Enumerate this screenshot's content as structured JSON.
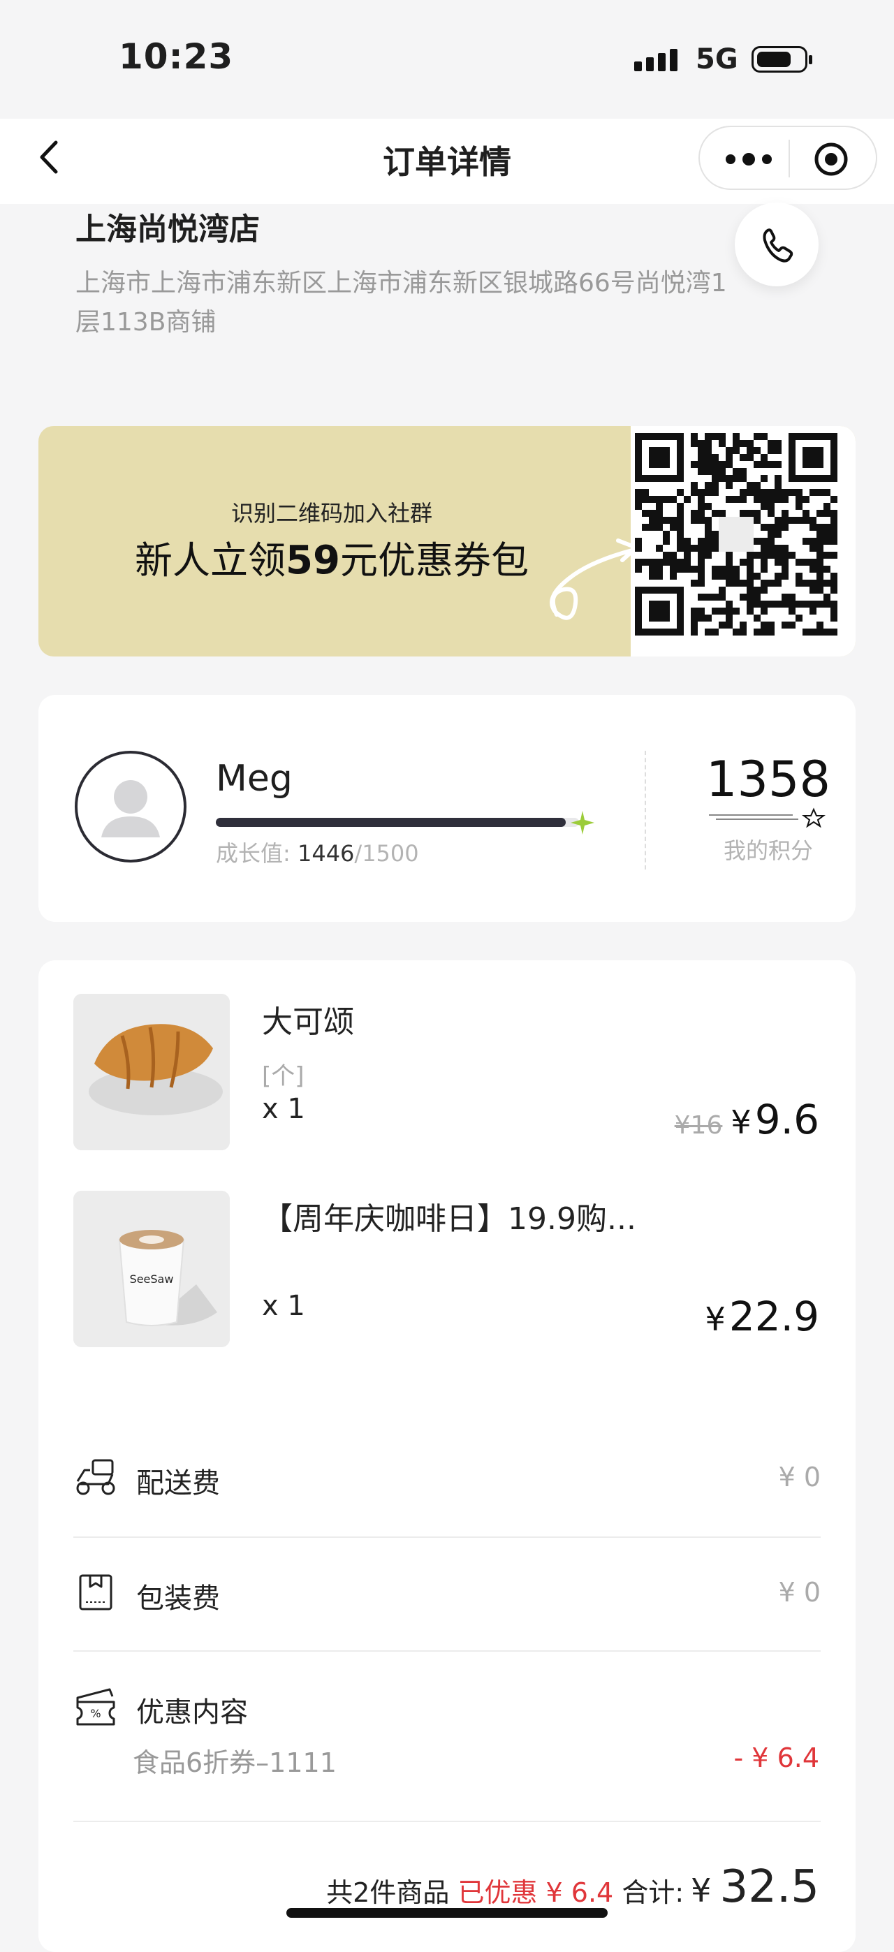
{
  "status_bar": {
    "time": "10:23",
    "network": "5G",
    "battery_level": 0.75
  },
  "nav": {
    "title": "订单详情",
    "back_icon": "chevron-left-icon",
    "more_icon": "more-dots-icon",
    "close_icon": "mini-program-close-icon"
  },
  "store": {
    "name": "上海尚悦湾店",
    "address": "上海市上海市浦东新区上海市浦东新区银城路66号尚悦湾1层113B商铺",
    "phone_icon": "phone-icon"
  },
  "banner": {
    "subtitle": "识别二维码加入社群",
    "title_prefix": "新人立领",
    "title_amount": "59",
    "title_suffix": "元优惠券包",
    "qr_icon": "qr-code",
    "background": "#e6ddae"
  },
  "member": {
    "name": "Meg",
    "growth_label": "成长值:",
    "growth_current": "1446",
    "growth_target": "/1500",
    "growth_progress": 0.964,
    "points": "1358",
    "points_label": "我的积分",
    "avatar_icon": "avatar-placeholder-icon"
  },
  "order": {
    "items": [
      {
        "name": "大可颂",
        "spec": "[个]",
        "qty": "x 1",
        "original_price": "¥16",
        "currency": "¥",
        "price": "9.6",
        "image": "croissant-image"
      },
      {
        "name": "【周年庆咖啡日】19.9购...",
        "spec": "",
        "qty": "x 1",
        "original_price": "",
        "currency": "¥",
        "price": "22.9",
        "image": "coffee-cup-image"
      }
    ],
    "delivery_fee": {
      "label": "配送费",
      "value": "¥ 0",
      "icon": "scooter-icon"
    },
    "packing_fee": {
      "label": "包装费",
      "value": "¥ 0",
      "icon": "package-icon"
    },
    "discount": {
      "label": "优惠内容",
      "icon": "coupon-icon",
      "name": "食品6折券–1111",
      "value": "- ¥ 6.4"
    },
    "summary": {
      "count_text": "共2件商品",
      "saved_text": "已优惠 ¥ 6.4",
      "total_label": "合计:",
      "total_currency": "¥",
      "total": "32.5"
    }
  },
  "colors": {
    "accent_red": "#e0363a",
    "banner_bg": "#e6ddae",
    "page_bg": "#f5f5f6"
  }
}
